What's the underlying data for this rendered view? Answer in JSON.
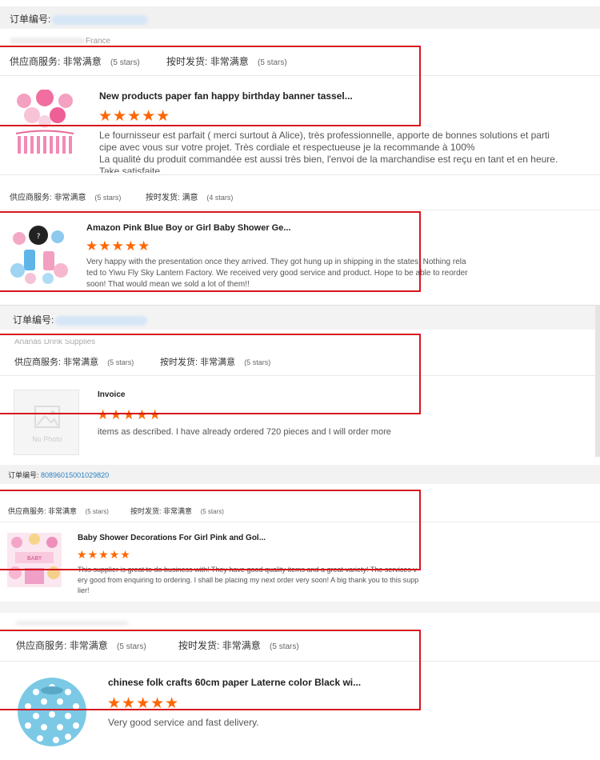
{
  "colors": {
    "accent_star": "#ff6600",
    "highlight_box": "#d6161d",
    "order_link": "#2a7fc0"
  },
  "orders": [
    {
      "order_label": "订单编号:",
      "country": "France",
      "supplier_label": "供应商服务:",
      "supplier_value": "非常满意",
      "supplier_stars": "(5 stars)",
      "delivery_label": "按时发货:",
      "delivery_value": "非常满意",
      "delivery_stars": "(5 stars)",
      "product_title": "New products paper fan happy birthday banner tassel...",
      "rating": "★★★★★",
      "review_lines": [
        "Le fournisseur est parfait ( merci surtout à Alice), très professionnelle, apporte de bonnes solutions et parti",
        "cipe avec vous sur votre projet. Très cordiale et respectueuse je la recommande à 100%",
        "La qualité du produit commandée est aussi très bien, l'envoi de la marchandise est reçu en tant et en heure.",
        "Take satisfaite"
      ]
    },
    {
      "supplier_label": "供应商服务:",
      "supplier_value": "非常满意",
      "supplier_stars": "(5 stars)",
      "delivery_label": "按时发货:",
      "delivery_value": "满意",
      "delivery_stars": "(4 stars)",
      "product_title": "Amazon Pink Blue Boy or Girl Baby Shower Ge...",
      "rating": "★★★★★",
      "review_lines": [
        "Very happy with the presentation once they arrived. They got hung up in shipping in the states. Nothing rela",
        "ted to Yiwu Fly Sky Lantern Factory. We received very good service and product. Hope to be able to reorder",
        "soon! That would mean we sold a lot of them!!"
      ]
    },
    {
      "order_label": "订单编号:",
      "company_partial": "Ananas Drink Supplies",
      "supplier_label": "供应商服务:",
      "supplier_value": "非常满意",
      "supplier_stars": "(5 stars)",
      "delivery_label": "按时发货:",
      "delivery_value": "非常满意",
      "delivery_stars": "(5 stars)",
      "product_title": "Invoice",
      "no_photo": "No Photo",
      "rating": "★★★★★",
      "review_lines": [
        "items as described. I have already ordered 720 pieces and I will order more"
      ]
    },
    {
      "order_label": "订单编号:",
      "order_number": "80896015001029820",
      "supplier_label": "供应商服务:",
      "supplier_value": "非常满意",
      "supplier_stars": "(5 stars)",
      "delivery_label": "按时发货:",
      "delivery_value": "非常满意",
      "delivery_stars": "(5 stars)",
      "product_title": "Baby Shower Decorations For Girl Pink and Gol...",
      "rating": "★★★★★",
      "review_lines": [
        "This supplier is great to do business with! They have good quality items and a great variety! The services v",
        "ery good from enquiring to ordering. I shall be placing my next order very soon! A big thank you to this supp",
        "lier!"
      ]
    },
    {
      "supplier_label": "供应商服务:",
      "supplier_value": "非常满意",
      "supplier_stars": "(5 stars)",
      "delivery_label": "按时发货:",
      "delivery_value": "非常满意",
      "delivery_stars": "(5 stars)",
      "product_title": "chinese folk crafts 60cm paper Laterne color Black wi...",
      "rating": "★★★★★",
      "review_lines": [
        "Very good service and fast delivery."
      ]
    }
  ]
}
